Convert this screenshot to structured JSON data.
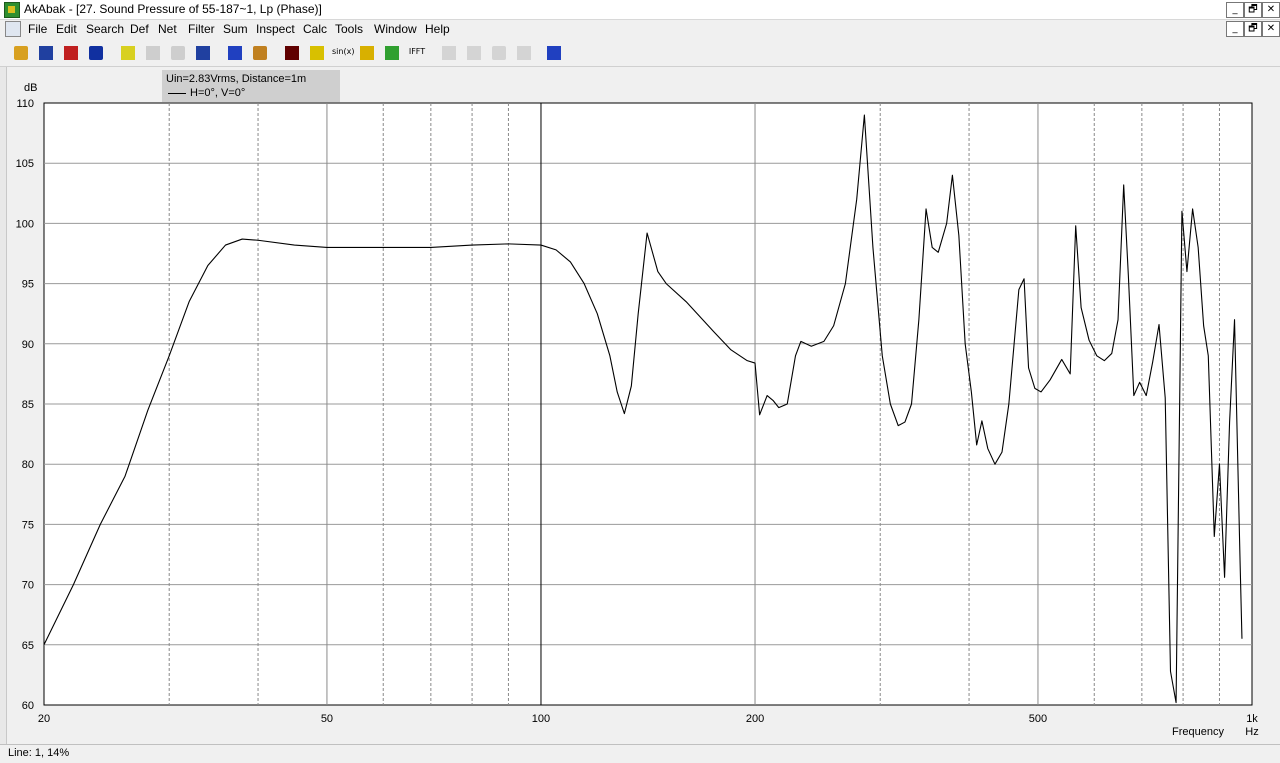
{
  "window": {
    "title": "AkAbak - [27. Sound Pressure of 55-187~1, Lp (Phase)]",
    "controls": [
      "_",
      "🗗",
      "✕"
    ]
  },
  "menu": {
    "items": [
      "File",
      "Edit",
      "Search",
      "Def",
      "Net",
      "Filter",
      "Sum",
      "Inspect",
      "Calc",
      "Tools",
      "Window",
      "Help"
    ]
  },
  "toolbar": {
    "buttons": [
      {
        "icon": "open-folder-icon",
        "color": "#d8a020",
        "enabled": true
      },
      {
        "icon": "save-disk-icon",
        "color": "#2040a0",
        "enabled": true
      },
      {
        "icon": "speaker-red-icon",
        "color": "#c02020",
        "enabled": true
      },
      {
        "icon": "speaker-blue-icon",
        "color": "#1030a0",
        "enabled": true
      },
      {
        "icon": "document-check-icon",
        "color": "#d8d020",
        "enabled": true
      },
      {
        "icon": "wand-icon",
        "color": "#909090",
        "enabled": false
      },
      {
        "icon": "ruler-icon",
        "color": "#909090",
        "enabled": false
      },
      {
        "icon": "graph-axes-icon",
        "color": "#2040a0",
        "enabled": true
      },
      {
        "icon": "driver-icon",
        "color": "#2040c0",
        "enabled": true
      },
      {
        "icon": "driver-orange-icon",
        "color": "#c08020",
        "enabled": true
      },
      {
        "icon": "book-icon",
        "color": "#600000",
        "enabled": true
      },
      {
        "icon": "oscillator-icon",
        "color": "#d8c000",
        "enabled": true
      },
      {
        "icon": "sine-icon",
        "color": "#000000",
        "enabled": true,
        "text": "sin(x)"
      },
      {
        "icon": "plot-yellow-icon",
        "color": "#d8b000",
        "enabled": true
      },
      {
        "icon": "plot-green-icon",
        "color": "#30a030",
        "enabled": true
      },
      {
        "icon": "ifft-icon",
        "color": "#c02020",
        "enabled": true,
        "text": "IFFT"
      },
      {
        "icon": "plot-gray1-icon",
        "color": "#a0a0a0",
        "enabled": false
      },
      {
        "icon": "plot-gray2-icon",
        "color": "#a0a0a0",
        "enabled": false
      },
      {
        "icon": "plot-gray3-icon",
        "color": "#a0a0a0",
        "enabled": false
      },
      {
        "icon": "plot-gray4-icon",
        "color": "#a0a0a0",
        "enabled": false
      },
      {
        "icon": "chart-window-icon",
        "color": "#2040c0",
        "enabled": true
      }
    ]
  },
  "legend": {
    "line1": "Uin=2.83Vrms, Distance=1m",
    "line2": "H=0°, V=0°"
  },
  "status": {
    "text": "Line: 1, 14%"
  },
  "chart_data": {
    "type": "line",
    "title": "",
    "xlabel": "Frequency",
    "ylabel": "dB",
    "xunit": "Hz",
    "xscale": "log",
    "xlim": [
      20,
      1000
    ],
    "ylim": [
      60,
      110
    ],
    "y_ticks": [
      60,
      65,
      70,
      75,
      80,
      85,
      90,
      95,
      100,
      105,
      110
    ],
    "x_tick_labels": [
      {
        "value": 20,
        "label": "20"
      },
      {
        "value": 50,
        "label": "50"
      },
      {
        "value": 100,
        "label": "100"
      },
      {
        "value": 200,
        "label": "200"
      },
      {
        "value": 500,
        "label": "500"
      },
      {
        "value": 1000,
        "label": "1k"
      }
    ],
    "x_grid": [
      20,
      30,
      40,
      50,
      60,
      70,
      80,
      90,
      100,
      200,
      300,
      400,
      500,
      600,
      700,
      800,
      900,
      1000
    ],
    "grid": true,
    "line_color": "#000000",
    "series": [
      {
        "name": "H=0°, V=0°",
        "points": [
          [
            20,
            65
          ],
          [
            22,
            70
          ],
          [
            24,
            75
          ],
          [
            26,
            79
          ],
          [
            28,
            84.5
          ],
          [
            30,
            89
          ],
          [
            32,
            93.5
          ],
          [
            34,
            96.5
          ],
          [
            36,
            98.2
          ],
          [
            38,
            98.7
          ],
          [
            40,
            98.6
          ],
          [
            45,
            98.2
          ],
          [
            50,
            98
          ],
          [
            60,
            98
          ],
          [
            70,
            98
          ],
          [
            80,
            98.2
          ],
          [
            90,
            98.3
          ],
          [
            100,
            98.2
          ],
          [
            105,
            97.8
          ],
          [
            110,
            96.8
          ],
          [
            115,
            95
          ],
          [
            120,
            92.5
          ],
          [
            125,
            89
          ],
          [
            128,
            86
          ],
          [
            131,
            84.2
          ],
          [
            134,
            86.5
          ],
          [
            137,
            92.5
          ],
          [
            141,
            99.2
          ],
          [
            146,
            96
          ],
          [
            150,
            95
          ],
          [
            160,
            93.5
          ],
          [
            175,
            91
          ],
          [
            185,
            89.5
          ],
          [
            195,
            88.6
          ],
          [
            200,
            88.4
          ],
          [
            203,
            84.1
          ],
          [
            208,
            85.7
          ],
          [
            212,
            85.3
          ],
          [
            216,
            84.7
          ],
          [
            222,
            85
          ],
          [
            228,
            89
          ],
          [
            232,
            90.2
          ],
          [
            240,
            89.8
          ],
          [
            250,
            90.2
          ],
          [
            258,
            91.5
          ],
          [
            268,
            95
          ],
          [
            278,
            102
          ],
          [
            285,
            109
          ],
          [
            293,
            98
          ],
          [
            302,
            89
          ],
          [
            310,
            85
          ],
          [
            318,
            83.2
          ],
          [
            325,
            83.5
          ],
          [
            332,
            85
          ],
          [
            340,
            92
          ],
          [
            348,
            101.2
          ],
          [
            355,
            98
          ],
          [
            362,
            97.6
          ],
          [
            372,
            100
          ],
          [
            379,
            104
          ],
          [
            387,
            99
          ],
          [
            395,
            90
          ],
          [
            403,
            86
          ],
          [
            410,
            81.6
          ],
          [
            417,
            83.6
          ],
          [
            425,
            81.3
          ],
          [
            435,
            80
          ],
          [
            445,
            81
          ],
          [
            455,
            85
          ],
          [
            470,
            94.5
          ],
          [
            478,
            95.4
          ],
          [
            485,
            88
          ],
          [
            495,
            86.3
          ],
          [
            505,
            86
          ],
          [
            520,
            87
          ],
          [
            540,
            88.7
          ],
          [
            555,
            87.5
          ],
          [
            565,
            99.8
          ],
          [
            575,
            93
          ],
          [
            590,
            90.3
          ],
          [
            605,
            89
          ],
          [
            620,
            88.6
          ],
          [
            635,
            89.2
          ],
          [
            648,
            92
          ],
          [
            660,
            103.2
          ],
          [
            670,
            95.7
          ],
          [
            682,
            85.7
          ],
          [
            695,
            86.8
          ],
          [
            710,
            85.7
          ],
          [
            725,
            88.5
          ],
          [
            740,
            91.6
          ],
          [
            755,
            85.5
          ],
          [
            768,
            62.8
          ],
          [
            782,
            60.2
          ],
          [
            797,
            101
          ],
          [
            810,
            96
          ],
          [
            825,
            101.2
          ],
          [
            840,
            98
          ],
          [
            855,
            91.5
          ],
          [
            868,
            89
          ],
          [
            885,
            74
          ],
          [
            900,
            80
          ],
          [
            915,
            70.6
          ],
          [
            930,
            83.5
          ],
          [
            945,
            92
          ],
          [
            962,
            72
          ],
          [
            968,
            65.5
          ]
        ]
      }
    ]
  }
}
